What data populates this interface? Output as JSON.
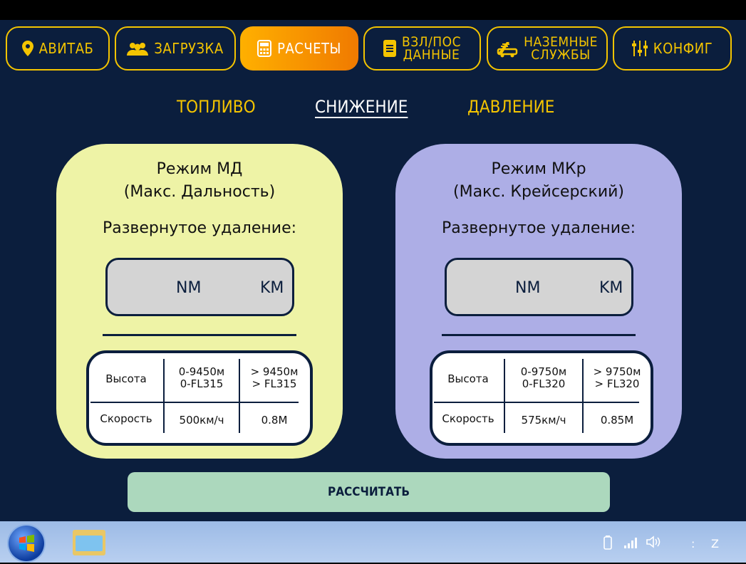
{
  "nav": {
    "tabs": [
      {
        "label": "АВИТАБ",
        "icon": "location-pin-icon"
      },
      {
        "label": "ЗАГРУЗКА",
        "icon": "people-icon"
      },
      {
        "label": "РАСЧЕТЫ",
        "icon": "calculator-icon",
        "active": true
      },
      {
        "line1": "ВЗЛ/ПОС",
        "line2": "ДАННЫЕ",
        "icon": "document-icon"
      },
      {
        "line1": "НАЗЕМНЫЕ",
        "line2": "СЛУЖБЫ",
        "icon": "ground-vehicle-icon"
      },
      {
        "label": "КОНФИГ",
        "icon": "sliders-icon"
      }
    ]
  },
  "subtabs": [
    {
      "label": "ТОПЛИВО",
      "active": false
    },
    {
      "label": "СНИЖЕНИЕ",
      "active": true
    },
    {
      "label": "ДАВЛЕНИЕ",
      "active": false
    }
  ],
  "cards": [
    {
      "title_line1": "Режим МД",
      "title_line2": "(Макс. Дальность)",
      "subtitle": "Развернутое удаление:",
      "unit_nm": "NM",
      "unit_km": "KM",
      "row1_label": "Высота",
      "row1_col1_line1": "0-9450м",
      "row1_col1_line2": "0-FL315",
      "row1_col2_line1": "> 9450м",
      "row1_col2_line2": "> FL315",
      "row2_label": "Скорость",
      "row2_col1": "500км/ч",
      "row2_col2": "0.8M",
      "color": "#eef3a6"
    },
    {
      "title_line1": "Режим МКр",
      "title_line2": "(Макс. Крейсерский)",
      "subtitle": "Развернутое удаление:",
      "unit_nm": "NM",
      "unit_km": "KM",
      "row1_label": "Высота",
      "row1_col1_line1": "0-9750м",
      "row1_col1_line2": "0-FL320",
      "row1_col2_line1": "> 9750м",
      "row1_col2_line2": "> FL320",
      "row2_label": "Скорость",
      "row2_col1": "575км/ч",
      "row2_col2": "0.85M",
      "color": "#adaee6"
    }
  ],
  "calc_button": "РАССЧИТАТЬ",
  "taskbar": {
    "clock": "Z",
    "separator": ":",
    "icons": [
      "windows-start-icon",
      "file-explorer-icon",
      "battery-icon",
      "signal-icon",
      "speaker-icon"
    ]
  },
  "colors": {
    "background": "#0b1e3d",
    "accent": "#f4c400",
    "active_tab": "#f07a00",
    "button": "#acd8bd"
  }
}
